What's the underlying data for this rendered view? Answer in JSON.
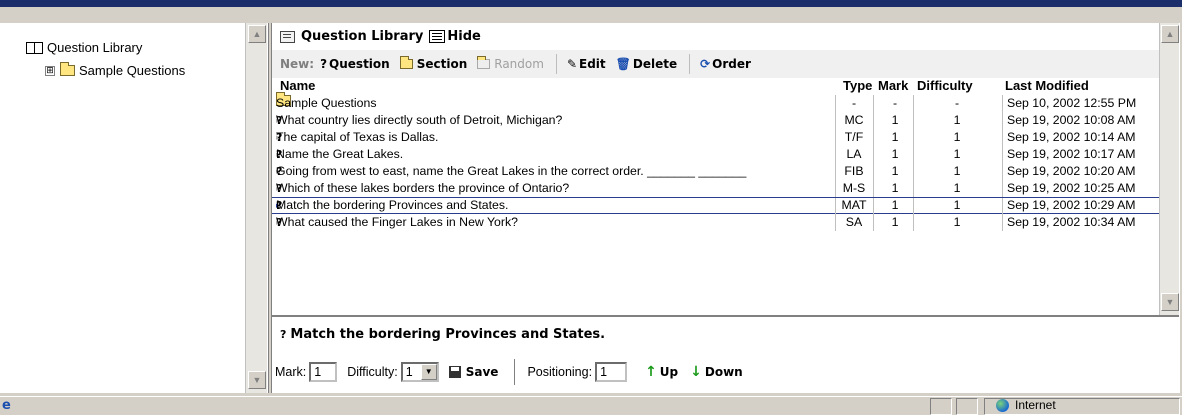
{
  "tree": {
    "root_label": "Question Library",
    "child_label": "Sample Questions",
    "expander": "⊞"
  },
  "library": {
    "title": "Question Library",
    "hide_label": "Hide"
  },
  "toolbar": {
    "new_label": "New:",
    "question_label": "Question",
    "section_label": "Section",
    "random_label": "Random",
    "edit_label": "Edit",
    "delete_label": "Delete",
    "order_label": "Order"
  },
  "columns": {
    "name": "Name",
    "type": "Type",
    "mark": "Mark",
    "difficulty": "Difficulty",
    "last_modified": "Last Modified"
  },
  "rows": [
    {
      "name": "Sample Questions",
      "type": "-",
      "mark": "-",
      "difficulty": "-",
      "last": "Sep 10, 2002 12:55 PM",
      "icon": "folder-icon"
    },
    {
      "name": "What country lies directly south of Detroit, Michigan?",
      "type": "MC",
      "mark": "1",
      "difficulty": "1",
      "last": "Sep 19, 2002 10:08 AM",
      "icon": "question-icon"
    },
    {
      "name": "The capital of Texas is Dallas.",
      "type": "T/F",
      "mark": "1",
      "difficulty": "1",
      "last": "Sep 19, 2002 10:14 AM",
      "icon": "question-icon"
    },
    {
      "name": "Name the Great Lakes.",
      "type": "LA",
      "mark": "1",
      "difficulty": "1",
      "last": "Sep 19, 2002 10:17 AM",
      "icon": "question-icon"
    },
    {
      "name": "Going from west to east, name the Great Lakes in the correct order. _______ _______",
      "type": "FIB",
      "mark": "1",
      "difficulty": "1",
      "last": "Sep 19, 2002 10:20 AM",
      "icon": "question-icon"
    },
    {
      "name": "Which of these lakes borders the province of Ontario?",
      "type": "M-S",
      "mark": "1",
      "difficulty": "1",
      "last": "Sep 19, 2002 10:25 AM",
      "icon": "question-icon"
    },
    {
      "name": "Match the bordering Provinces and States.",
      "type": "MAT",
      "mark": "1",
      "difficulty": "1",
      "last": "Sep 19, 2002 10:29 AM",
      "icon": "question-icon",
      "selected": true
    },
    {
      "name": "What caused the Finger Lakes in New York?",
      "type": "SA",
      "mark": "1",
      "difficulty": "1",
      "last": "Sep 19, 2002 10:34 AM",
      "icon": "question-icon"
    }
  ],
  "detail": {
    "title": "Match the bordering Provinces and States.",
    "mark_label": "Mark:",
    "mark_value": "1",
    "difficulty_label": "Difficulty:",
    "difficulty_value": "1",
    "save_label": "Save",
    "positioning_label": "Positioning:",
    "positioning_value": "1",
    "up_label": "Up",
    "down_label": "Down"
  },
  "status": {
    "zone_label": "Internet"
  }
}
